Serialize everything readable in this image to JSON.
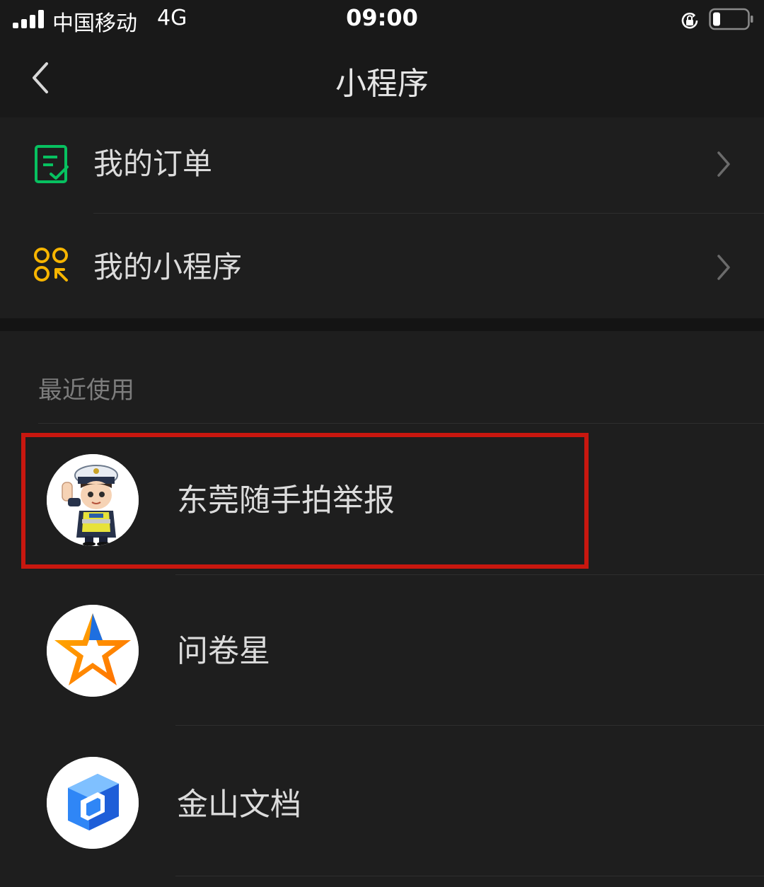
{
  "status_bar": {
    "carrier": "中国移动",
    "network": "4G",
    "time": "09:00",
    "signal_icon": "signal-bars-icon",
    "rotation_lock_icon": "rotation-lock-icon",
    "battery_icon": "battery-icon"
  },
  "nav": {
    "title": "小程序",
    "back_icon": "chevron-left-icon"
  },
  "menu": {
    "items": [
      {
        "label": "我的订单",
        "icon": "order-checklist-icon",
        "icon_color": "#07c160"
      },
      {
        "label": "我的小程序",
        "icon": "mini-program-grid-icon",
        "icon_color": "#f7b500"
      }
    ]
  },
  "recent": {
    "header": "最近使用",
    "apps": [
      {
        "name": "东莞随手拍举报",
        "icon": "traffic-police-avatar-icon",
        "highlighted": true
      },
      {
        "name": "问卷星",
        "icon": "star-logo-icon",
        "highlighted": false
      },
      {
        "name": "金山文档",
        "icon": "kingsoft-docs-logo-icon",
        "highlighted": false
      }
    ]
  },
  "colors": {
    "background": "#1e1e1e",
    "bar_background": "#191919",
    "highlight_border": "#c8170f"
  }
}
